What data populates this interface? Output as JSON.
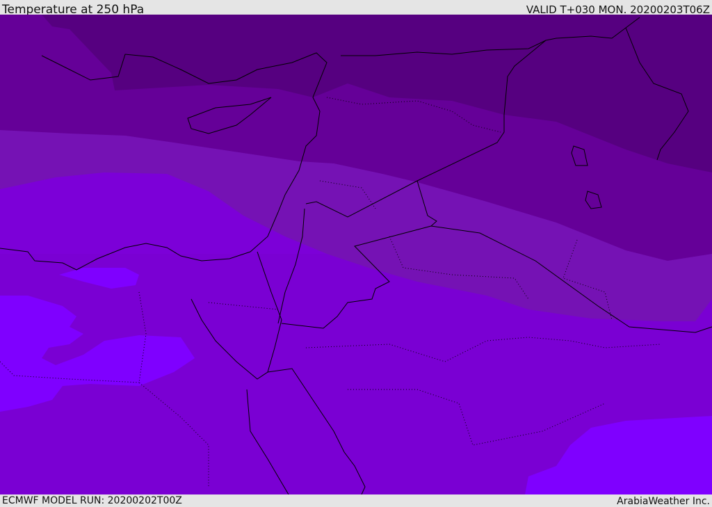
{
  "header": {
    "title": "Temperature at 250 hPa",
    "valid": "VALID T+030 MON. 20200203T06Z"
  },
  "footer": {
    "model_run": "ECMWF MODEL RUN: 20200202T00Z",
    "credit": "ArabiaWeather Inc."
  },
  "colors": {
    "band1": "#560080",
    "band2": "#650098",
    "band3": "#7512b4",
    "band4": "#7c00d8",
    "band5": "#7f00ff"
  }
}
